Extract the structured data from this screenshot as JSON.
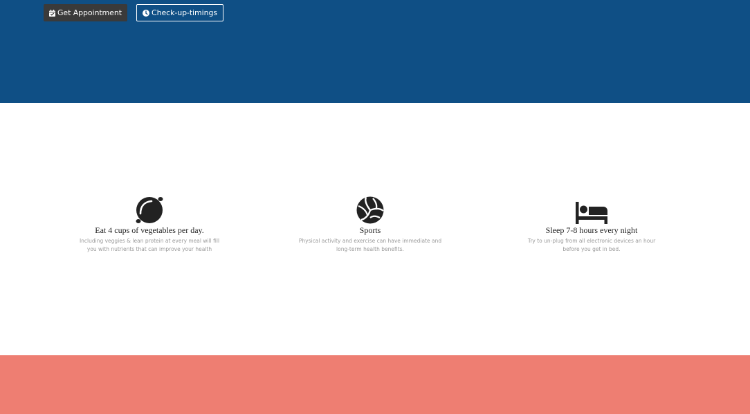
{
  "colors": {
    "hero_bg": "#0f4f85",
    "footer_bg": "#ee7e72",
    "appointment_btn_bg": "#3a3a3a",
    "icon_color": "#222222"
  },
  "header": {
    "appointment_button": {
      "label": "Get Appointment",
      "icon": "calendar-check-icon"
    },
    "timings_button": {
      "label": "Check-up-timings",
      "icon": "clock-icon"
    }
  },
  "features": [
    {
      "icon": "lemon-icon",
      "title": "Eat 4 cups of vegetables per day.",
      "description": "Including veggies & lean protein at every meal will fill you with nutrients that can improve your health"
    },
    {
      "icon": "volleyball-icon",
      "title": "Sports",
      "description": "Physical activity and exercise can have immediate and long-term health benefits."
    },
    {
      "icon": "bed-icon",
      "title": "Sleep 7-8 hours every night",
      "description": "Try to un-plug from all electronic devices an hour before you get in bed."
    }
  ]
}
